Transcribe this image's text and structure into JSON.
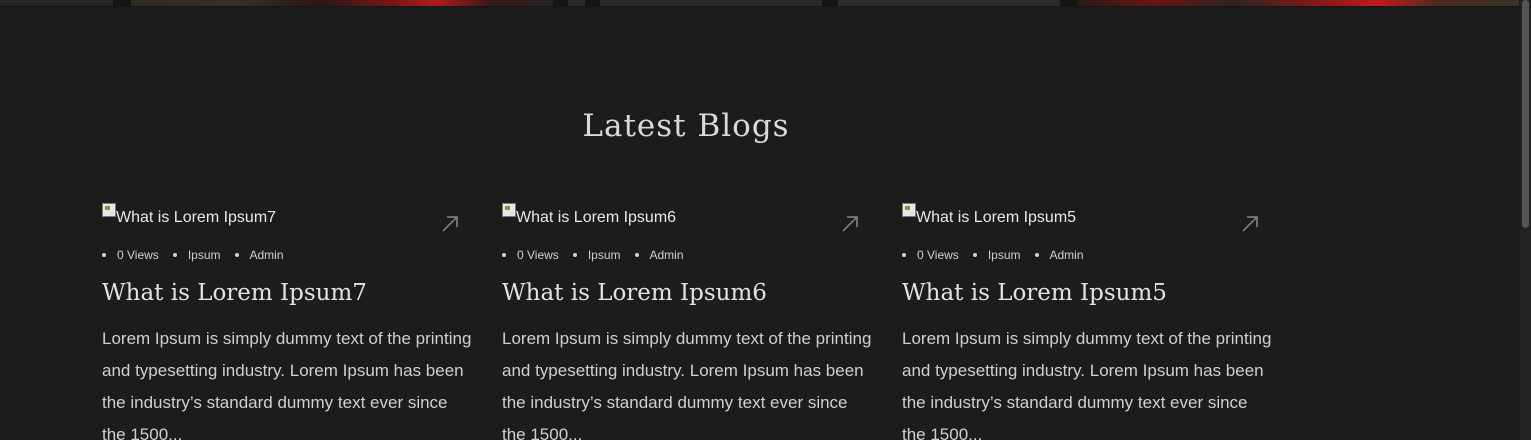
{
  "section": {
    "title": "Latest Blogs"
  },
  "blogs": [
    {
      "image_alt": "What is Lorem Ipsum7",
      "meta": [
        "0 Views",
        "Ipsum",
        "Admin"
      ],
      "title": "What is Lorem Ipsum7",
      "excerpt": "Lorem Ipsum is simply dummy text of the printing and typesetting industry. Lorem Ipsum has been the industry’s standard dummy text ever since the 1500..."
    },
    {
      "image_alt": "What is Lorem Ipsum6",
      "meta": [
        "0 Views",
        "Ipsum",
        "Admin"
      ],
      "title": "What is Lorem Ipsum6",
      "excerpt": "Lorem Ipsum is simply dummy text of the printing and typesetting industry. Lorem Ipsum has been the industry’s standard dummy text ever since the 1500..."
    },
    {
      "image_alt": "What is Lorem Ipsum5",
      "meta": [
        "0 Views",
        "Ipsum",
        "Admin"
      ],
      "title": "What is Lorem Ipsum5",
      "excerpt": "Lorem Ipsum is simply dummy text of the printing and typesetting industry. Lorem Ipsum has been the industry’s standard dummy text ever since the 1500..."
    }
  ],
  "icons": {
    "arrow": "arrow-up-right-icon",
    "broken_image": "broken-image-icon"
  },
  "colors": {
    "background": "#1c1c1c",
    "text": "#d9d9d9",
    "arrow": "#8a8a8a"
  }
}
